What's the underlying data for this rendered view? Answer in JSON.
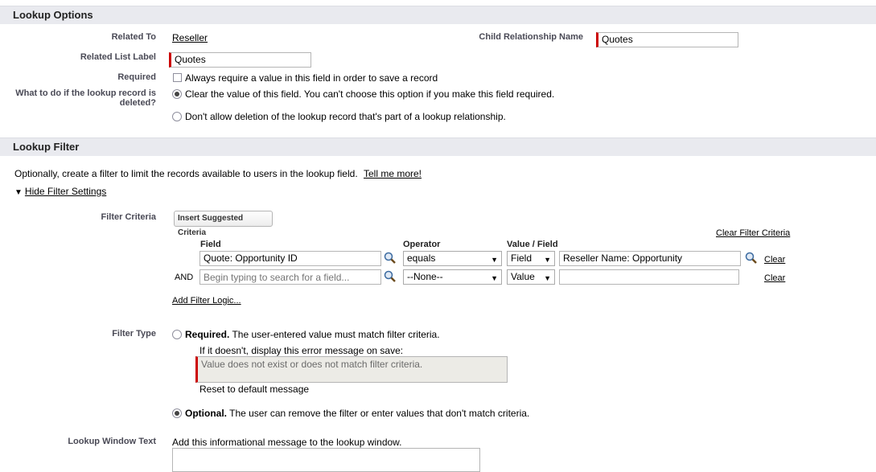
{
  "lookup_options": {
    "section_title": "Lookup Options",
    "related_to_label": "Related To",
    "related_to_value": "Reseller",
    "child_rel_label": "Child Relationship Name",
    "child_rel_value": "Quotes",
    "related_list_label": "Related List Label",
    "related_list_value": "Quotes",
    "required_label": "Required",
    "required_checkbox_text": "Always require a value in this field in order to save a record",
    "deleted_label_line1": "What to do if the lookup record is",
    "deleted_label_line2": "deleted?",
    "option_clear": "Clear the value of this field. You can't choose this option if you make this field required.",
    "option_dont_allow": "Don't allow deletion of the lookup record that's part of a lookup relationship."
  },
  "lookup_filter": {
    "section_title": "Lookup Filter",
    "intro": "Optionally, create a filter to limit the records available to users in the lookup field.",
    "tell_me_more": "Tell me more!",
    "hide_filter_settings": "Hide Filter Settings",
    "filter_criteria_label": "Filter Criteria",
    "insert_suggested": "Insert Suggested Criteria",
    "clear_filter_criteria": "Clear Filter Criteria",
    "col_field": "Field",
    "col_operator": "Operator",
    "col_value_field": "Value / Field",
    "rows": [
      {
        "prefix": "",
        "field": "Quote: Opportunity ID",
        "operator": "equals",
        "type": "Field",
        "value": "Reseller Name: Opportunity",
        "clear": "Clear"
      },
      {
        "prefix": "AND",
        "field_placeholder": "Begin typing to search for a field...",
        "operator": "--None--",
        "type": "Value",
        "value": "",
        "clear": "Clear"
      }
    ],
    "add_filter_logic": "Add Filter Logic...",
    "filter_type_label": "Filter Type",
    "required_bold": "Required.",
    "required_text": "The user-entered value must match filter criteria.",
    "error_msg_label": "If it doesn't, display this error message on save:",
    "error_msg_value": "Value does not exist or does not match filter criteria.",
    "reset_default": "Reset to default message",
    "optional_bold": "Optional.",
    "optional_text": "The user can remove the filter or enter values that don't match criteria.",
    "window_text_label": "Lookup Window Text",
    "window_text_hint": "Add this informational message to the lookup window."
  }
}
